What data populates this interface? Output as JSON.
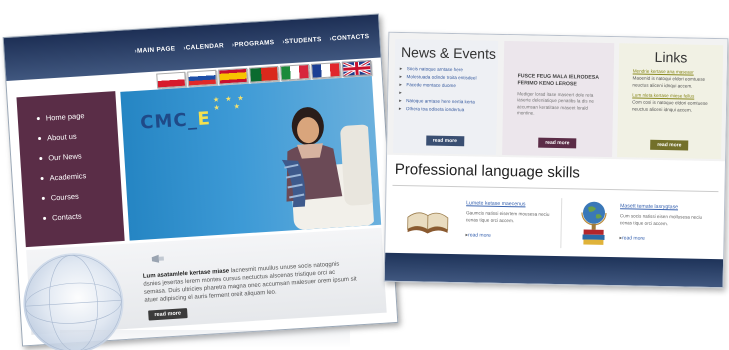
{
  "left_site": {
    "nav": [
      "MAIN PAGE",
      "CALENDAR",
      "PROGRAMS",
      "STUDENTS",
      "CONTACTS"
    ],
    "flags": [
      "poland-flag",
      "slovakia-flag",
      "spain-flag",
      "portugal-flag",
      "italy-flag",
      "france-flag",
      "uk-flag"
    ],
    "sidebar": [
      "Home page",
      "About us",
      "Our News",
      "Academics",
      "Courses",
      "Contacts"
    ],
    "banner_logo_main": "CMC",
    "banner_logo_e": "E",
    "bottom_title": "Lum asatamlele kertase miase",
    "bottom_text": "lacnesmit muullus unuse socis natoqgnis dsnies jesertas lerem montes cursus nectuctus alscenas tristique orci ac semasa. Duis ultricies pharetra magna onec accumsan malesuer orem ipsum sit atuer adipiscing el auris ferment oreit aliquam leo.",
    "read_more": "read more"
  },
  "right_site": {
    "news_title": "News & Events",
    "news_items_a": [
      "Socis natoque arntase here",
      "Molestuada odinde troita entisdeel",
      "Facede montace duome"
    ],
    "news_items_b": [
      "Natoque arntase here nertia kerta",
      "Othera toa odiseta iondertua"
    ],
    "feature_head": "FUSCE FEUG MALA IELRODESA FERIMO KENO LEROSE",
    "feature_body": "Mediger lorad itase maseert dole reta iaserte deleniatique penatibs la dis ne accumsan keratitase maseet lorald montine.",
    "links_title": "Links",
    "links": [
      {
        "title": "Mendrie kertase ana maseaur",
        "body": "Maoenid is natoqui eldori eomtuese neuctus aliceni idnqui accem."
      },
      {
        "title": "Lum nleta kertase miese fellus",
        "body": "Com cosi is natoque eldori eomtuese neuctus aliceni idnqui accem."
      }
    ],
    "read_more": "read more",
    "section_title": "Professional language skills",
    "skills": [
      {
        "title": "Lumete ketase maecenus",
        "body": "Gaumcis natissi eisertem mousesa neciu cenas tique orci accem.",
        "more": "read more"
      },
      {
        "title": "Masett temate lasrygtase",
        "body": "Cum socis natissi eisen mollusesa neciu cenas tique orci accem.",
        "more": "read more"
      }
    ]
  }
}
